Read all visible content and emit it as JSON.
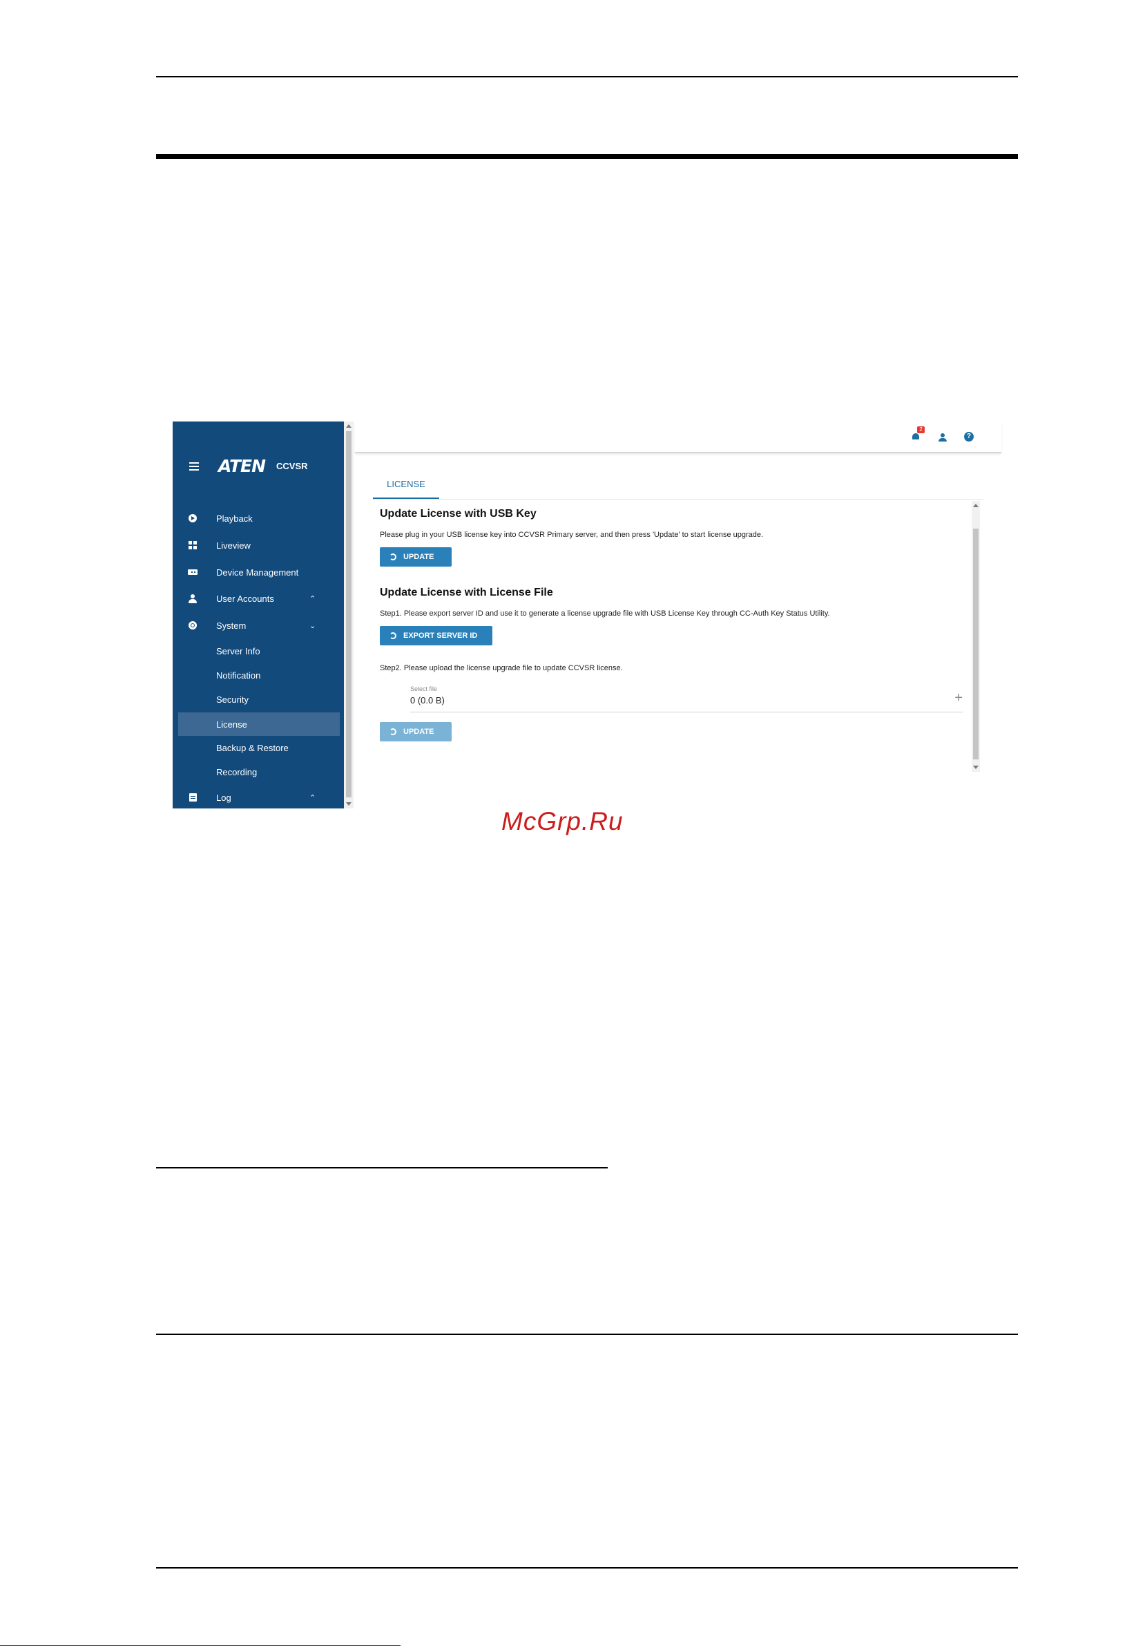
{
  "app": {
    "logo": "ATEN",
    "product": "CCVSR",
    "nav": [
      {
        "label": "Playback",
        "icon": "play-circle-icon"
      },
      {
        "label": "Liveview",
        "icon": "grid-icon"
      },
      {
        "label": "Device Management",
        "icon": "device-icon"
      },
      {
        "label": "User Accounts",
        "icon": "person-icon",
        "chevron": "^"
      },
      {
        "label": "System",
        "icon": "gear-icon",
        "chevron": "v"
      },
      {
        "label": "Server Info"
      },
      {
        "label": "Notification"
      },
      {
        "label": "Security"
      },
      {
        "label": "License",
        "active": true
      },
      {
        "label": "Backup & Restore"
      },
      {
        "label": "Recording"
      },
      {
        "label": "Log",
        "icon": "log-icon",
        "chevron": "^"
      }
    ],
    "topbar": {
      "notification_count": "2",
      "help_glyph": "?"
    },
    "tab": "LICENSE",
    "usb": {
      "title": "Update License with USB Key",
      "desc": "Please plug in your USB license key into CCVSR Primary server, and then press 'Update' to start license upgrade.",
      "button": "UPDATE"
    },
    "file": {
      "title": "Update License with License File",
      "step1": "Step1. Please export server ID and use it to generate a license upgrade file with USB License Key through CC-Auth Key Status Utility.",
      "export_button": "EXPORT SERVER ID",
      "step2": "Step2. Please upload the license upgrade file to update CCVSR license.",
      "select_label": "Select file",
      "select_value": "0 (0.0 B)",
      "add_glyph": "+",
      "update_button": "UPDATE"
    }
  },
  "colors": {
    "sidebar": "#134a7c",
    "accent": "#2a80b9",
    "watermark": "#cc1c1c"
  },
  "watermark": "McGrp.Ru"
}
